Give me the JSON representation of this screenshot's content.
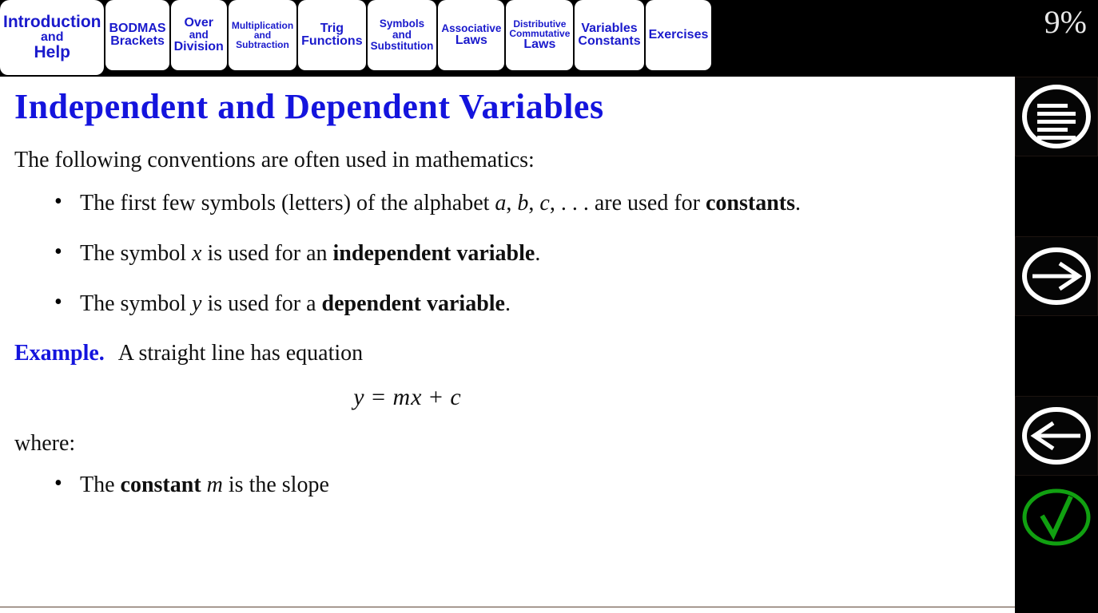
{
  "tabs": [
    {
      "id": "introduction-help",
      "lines": [
        "Introduction",
        "and",
        "Help"
      ],
      "sizes": [
        "big",
        "mid",
        "big"
      ],
      "active": true
    },
    {
      "id": "bodmas-brackets",
      "lines": [
        "BODMAS",
        "Brackets"
      ],
      "sizes": [
        "mid",
        "mid"
      ],
      "active": false
    },
    {
      "id": "over-division",
      "lines": [
        "Over",
        "and",
        "Division"
      ],
      "sizes": [
        "mid",
        "small",
        "mid"
      ],
      "active": false
    },
    {
      "id": "multiplication-subtraction",
      "lines": [
        "Multiplication",
        "and",
        "Subtraction"
      ],
      "sizes": [
        "tiny",
        "tiny",
        "tiny"
      ],
      "active": false
    },
    {
      "id": "trig-functions",
      "lines": [
        "Trig",
        "Functions"
      ],
      "sizes": [
        "mid",
        "mid"
      ],
      "active": false
    },
    {
      "id": "symbols-substitution",
      "lines": [
        "Symbols",
        "and",
        "Substitution"
      ],
      "sizes": [
        "small",
        "small",
        "small"
      ],
      "active": false
    },
    {
      "id": "associative-laws",
      "lines": [
        "Associative",
        "Laws"
      ],
      "sizes": [
        "small",
        "mid"
      ],
      "active": false
    },
    {
      "id": "distributive-commutative-laws",
      "lines": [
        "Distributive",
        "Commutative",
        "Laws"
      ],
      "sizes": [
        "tiny",
        "tiny",
        "mid"
      ],
      "active": false
    },
    {
      "id": "variables-constants",
      "lines": [
        "Variables",
        "Constants"
      ],
      "sizes": [
        "mid",
        "mid"
      ],
      "active": false
    },
    {
      "id": "exercises",
      "lines": [
        "Exercises"
      ],
      "sizes": [
        "mid"
      ],
      "active": false
    }
  ],
  "header": {
    "progress_percent": "9%"
  },
  "slide": {
    "title": "Independent and Dependent Variables",
    "intro": "The following conventions are often used in mathematics:",
    "bullets": [
      {
        "parts": [
          {
            "t": "The first few symbols (letters) of the alphabet ",
            "style": "normal"
          },
          {
            "t": "a",
            "style": "math"
          },
          {
            "t": ", ",
            "style": "normal"
          },
          {
            "t": "b",
            "style": "math"
          },
          {
            "t": ", ",
            "style": "normal"
          },
          {
            "t": "c",
            "style": "math"
          },
          {
            "t": ", . . . are used for ",
            "style": "normal"
          },
          {
            "t": "constants",
            "style": "bold"
          },
          {
            "t": ".",
            "style": "normal"
          }
        ]
      },
      {
        "parts": [
          {
            "t": "The symbol ",
            "style": "normal"
          },
          {
            "t": "x",
            "style": "math"
          },
          {
            "t": " is used for an ",
            "style": "normal"
          },
          {
            "t": "independent variable",
            "style": "bold"
          },
          {
            "t": ".",
            "style": "normal"
          }
        ]
      },
      {
        "parts": [
          {
            "t": "The symbol ",
            "style": "normal"
          },
          {
            "t": "y",
            "style": "math"
          },
          {
            "t": " is used for a ",
            "style": "normal"
          },
          {
            "t": "dependent variable",
            "style": "bold"
          },
          {
            "t": ".",
            "style": "normal"
          }
        ]
      }
    ],
    "example_label": "Example.",
    "example_text": "A straight line has equation",
    "equation": {
      "lhs": "y",
      "eq": " = ",
      "rhs_1": "mx",
      "plus": " + ",
      "rhs_2": "c"
    },
    "where_label": "where:",
    "where_bullets": [
      {
        "parts": [
          {
            "t": "The ",
            "style": "normal"
          },
          {
            "t": "constant",
            "style": "bold"
          },
          {
            "t": " ",
            "style": "normal"
          },
          {
            "t": "m",
            "style": "math"
          },
          {
            "t": " is the slope",
            "style": "normal"
          }
        ]
      }
    ]
  },
  "sidebar": {
    "buttons": [
      {
        "id": "contents",
        "icon": "contents-lines-icon",
        "color": "#ffffff"
      },
      {
        "id": "next-page",
        "icon": "arrow-right-icon",
        "color": "#ffffff"
      },
      {
        "id": "previous-page",
        "icon": "arrow-left-icon",
        "color": "#ffffff"
      },
      {
        "id": "answer-check",
        "icon": "check-circle-icon",
        "color": "#11a011"
      }
    ]
  },
  "colors": {
    "tab_text": "#1a1aCC",
    "title_blue": "#1414DD",
    "body_black": "#101010",
    "background": "#000000",
    "paper": "#ffffff",
    "check_green": "#11a011"
  }
}
